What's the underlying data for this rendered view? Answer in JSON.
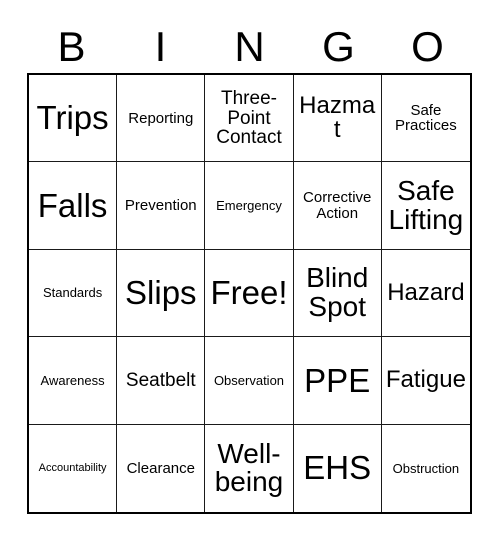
{
  "card": {
    "type": "bingo-card",
    "topic": "Workplace Safety",
    "header": {
      "letters": [
        "B",
        "I",
        "N",
        "G",
        "O"
      ]
    },
    "grid": {
      "rows": 5,
      "columns": 5,
      "free_space": {
        "row": 3,
        "column": 3,
        "label": "Free!"
      },
      "border_color": "#000000",
      "cell_background": "#ffffff",
      "text_color": "#000000",
      "cells": [
        [
          {
            "label": "Trips",
            "size": "xxl"
          },
          {
            "label": "Reporting",
            "size": "sm"
          },
          {
            "label": "Three-Point Contact",
            "size": "md"
          },
          {
            "label": "Hazmat",
            "size": "lg"
          },
          {
            "label": "Safe Practices",
            "size": "sm"
          }
        ],
        [
          {
            "label": "Falls",
            "size": "xxl"
          },
          {
            "label": "Prevention",
            "size": "sm"
          },
          {
            "label": "Emergency",
            "size": "xs"
          },
          {
            "label": "Corrective Action",
            "size": "sm"
          },
          {
            "label": "Safe Lifting",
            "size": "xl"
          }
        ],
        [
          {
            "label": "Standards",
            "size": "xs"
          },
          {
            "label": "Slips",
            "size": "xxl"
          },
          {
            "label": "Free!",
            "size": "xxl"
          },
          {
            "label": "Blind Spot",
            "size": "xl"
          },
          {
            "label": "Hazard",
            "size": "lg"
          }
        ],
        [
          {
            "label": "Awareness",
            "size": "xs"
          },
          {
            "label": "Seatbelt",
            "size": "md"
          },
          {
            "label": "Observation",
            "size": "xs"
          },
          {
            "label": "PPE",
            "size": "xxl"
          },
          {
            "label": "Fatigue",
            "size": "lg"
          }
        ],
        [
          {
            "label": "Accountability",
            "size": "xxs"
          },
          {
            "label": "Clearance",
            "size": "sm"
          },
          {
            "label": "Well-being",
            "size": "xl"
          },
          {
            "label": "EHS",
            "size": "xxl"
          },
          {
            "label": "Obstruction",
            "size": "xs"
          }
        ]
      ]
    }
  }
}
